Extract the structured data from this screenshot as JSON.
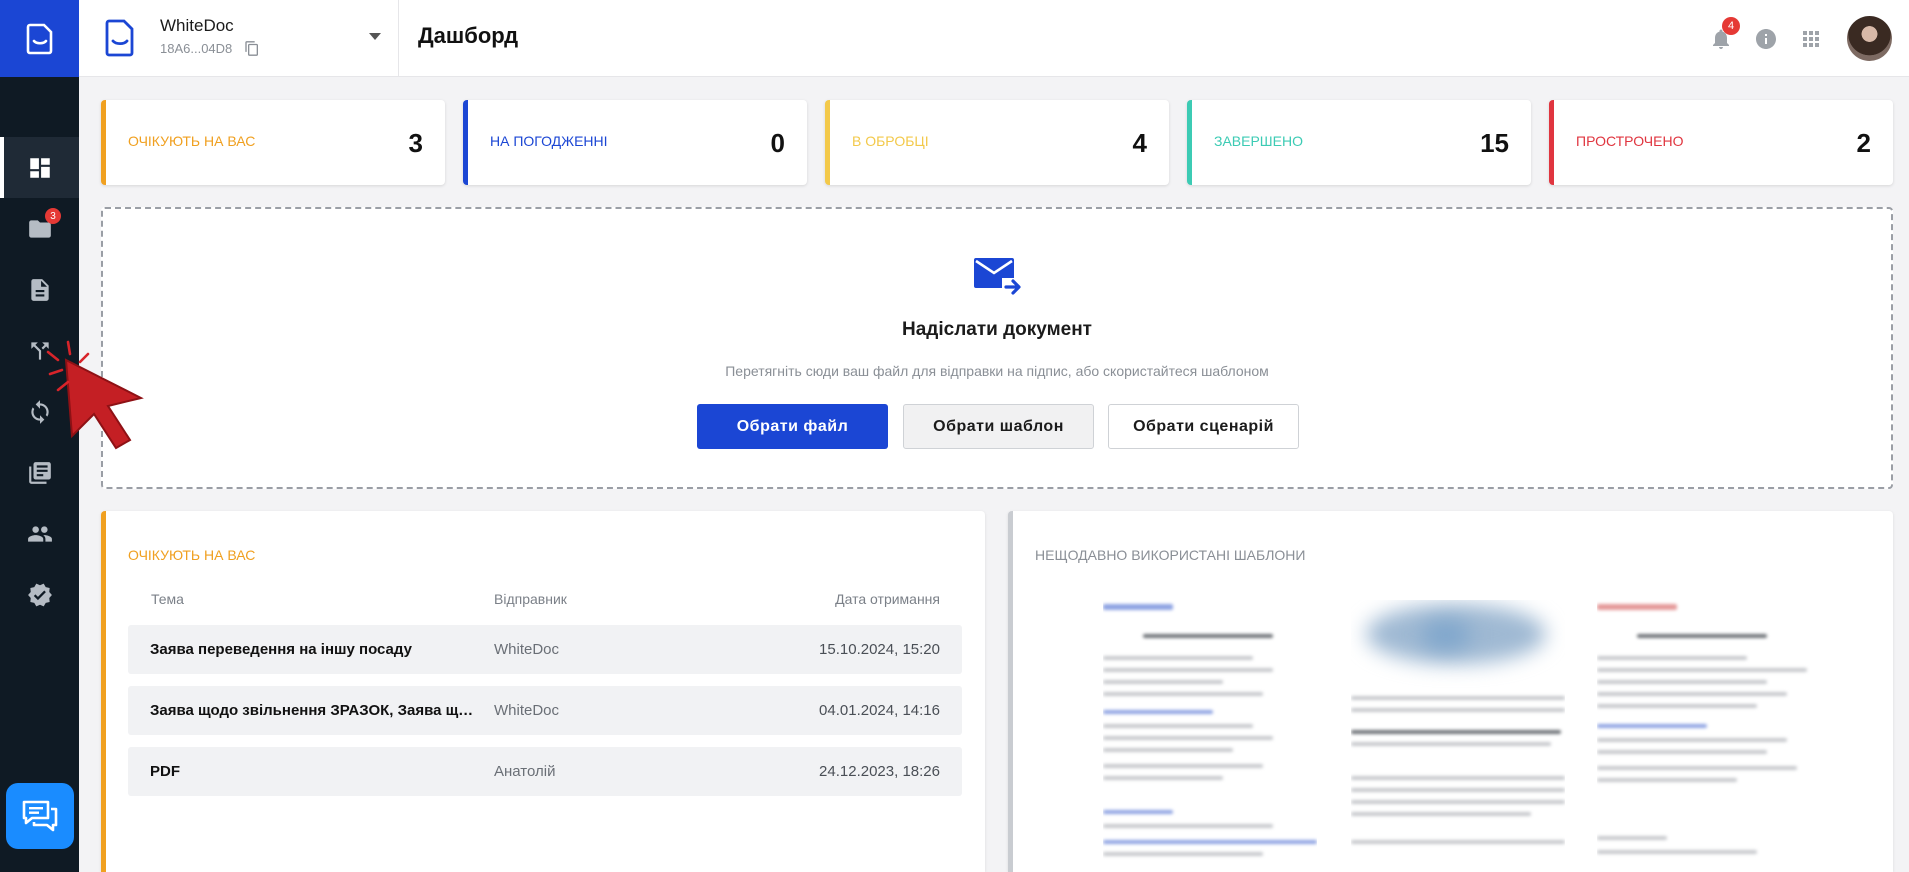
{
  "app": {
    "name": "WhiteDoc"
  },
  "org": {
    "name": "WhiteDoc",
    "id": "18A6...04D8"
  },
  "header": {
    "title": "Дашборд",
    "notifications_count": "4"
  },
  "sidebar": {
    "items": [
      {
        "name": "dashboard",
        "icon": "dashboard-icon",
        "active": true
      },
      {
        "name": "documents-folder",
        "icon": "folder-icon",
        "badge": "3"
      },
      {
        "name": "document",
        "icon": "document-icon"
      },
      {
        "name": "routes",
        "icon": "routes-icon"
      },
      {
        "name": "sync",
        "icon": "sync-icon"
      },
      {
        "name": "library",
        "icon": "library-icon"
      },
      {
        "name": "users",
        "icon": "users-icon"
      },
      {
        "name": "verified",
        "icon": "verified-icon"
      }
    ]
  },
  "stats": [
    {
      "label": "ОЧІКУЮТЬ НА ВАС",
      "value": "3",
      "color": "#f0a020"
    },
    {
      "label": "НА ПОГОДЖЕННІ",
      "value": "0",
      "color": "#1b46d4"
    },
    {
      "label": "В ОБРОБЦІ",
      "value": "4",
      "color": "#f3c94a"
    },
    {
      "label": "ЗАВЕРШЕНО",
      "value": "15",
      "color": "#3ccbb4"
    },
    {
      "label": "ПРОСТРОЧЕНО",
      "value": "2",
      "color": "#e0353f"
    }
  ],
  "upload": {
    "title": "Надіслати документ",
    "subtitle": "Перетягніть сюди ваш файл для відправки на підпис, або скористайтеся шаблоном",
    "buttons": {
      "file": "Обрати файл",
      "template": "Обрати шаблон",
      "scenario": "Обрати сценарій"
    }
  },
  "pending": {
    "title": "ОЧІКУЮТЬ НА ВАС",
    "columns": {
      "subject": "Тема",
      "sender": "Відправник",
      "date": "Дата отримання"
    },
    "rows": [
      {
        "subject": "Заява переведення на іншу посаду",
        "sender": "WhiteDoc",
        "date": "15.10.2024, 15:20"
      },
      {
        "subject": "Заява щодо звільнення ЗРАЗОК, Заява щодо звільнення",
        "sender": "WhiteDoc",
        "date": "04.01.2024, 14:16"
      },
      {
        "subject": "PDF",
        "sender": "Анатолій",
        "date": "24.12.2023, 18:26"
      }
    ]
  },
  "templates": {
    "title": "НЕЩОДАВНО ВИКОРИСТАНІ ШАБЛОНИ"
  },
  "colors": {
    "accent": "#1b46d4",
    "sidebar": "#0f1a24",
    "pending": "#f0a020",
    "templates_border": "#c9ccd1"
  }
}
